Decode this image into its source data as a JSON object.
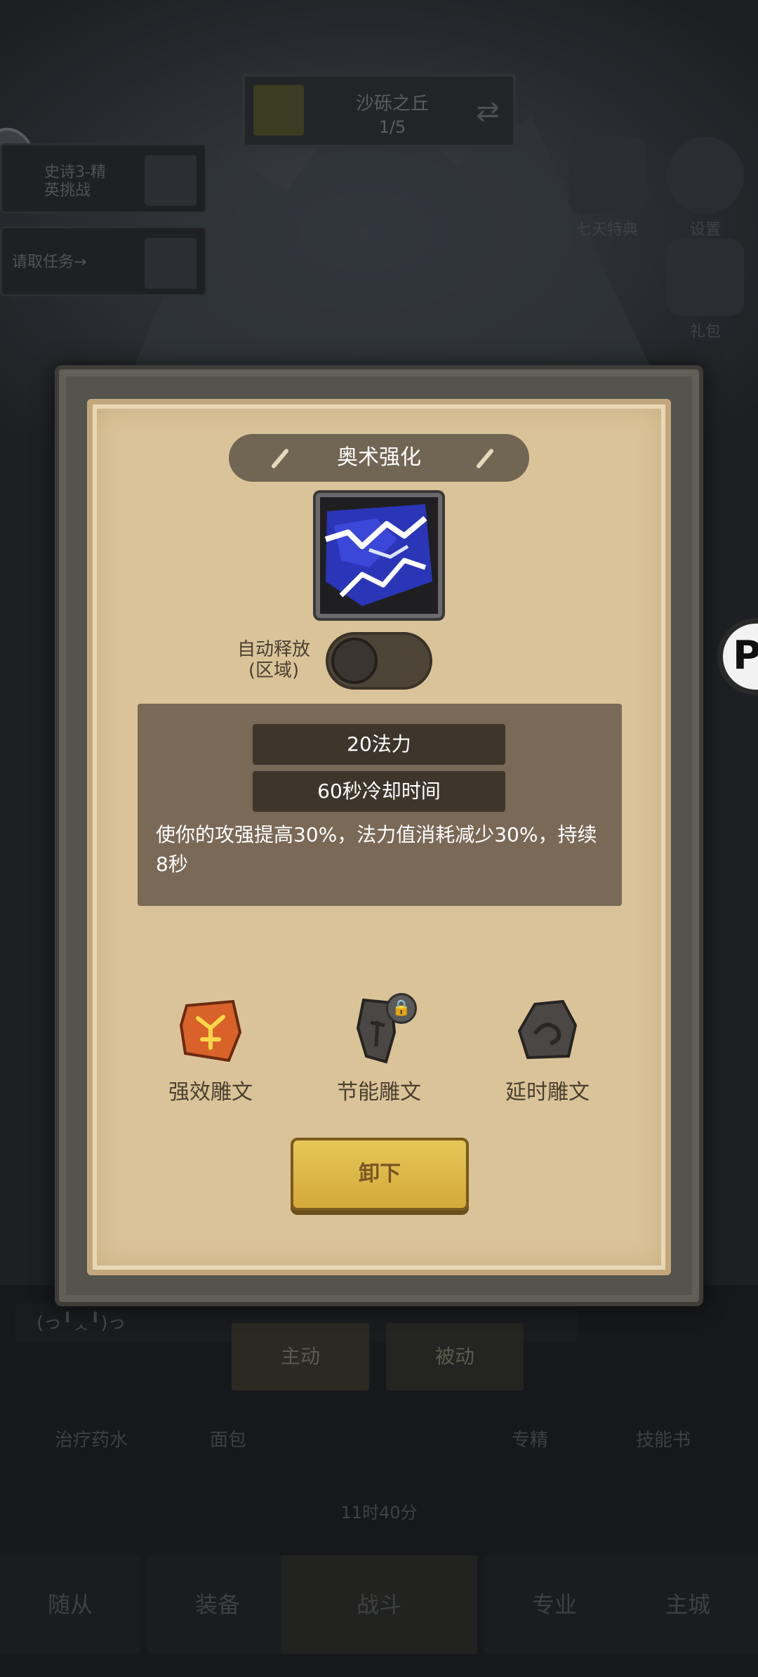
{
  "background": {
    "stage": {
      "name": "沙砾之丘",
      "progress": "1/5"
    },
    "tasks": [
      "史诗3-精\n英挑战",
      "请取任务→"
    ],
    "side_icons": [
      "七天特典",
      "设置",
      "礼包"
    ],
    "chat_placeholder": "(っ╹ᆺ╹)っ",
    "mode_tabs": [
      "主动",
      "被动"
    ],
    "items": [
      "治疗药水",
      "面包",
      "专精",
      "技能书"
    ],
    "timer": "11时40分",
    "nav": [
      "随从",
      "装备",
      "战斗",
      "专业",
      "主城"
    ],
    "edge_button": "P"
  },
  "modal": {
    "title": "奥术强化",
    "skill_icon": "arcane-lightning-icon",
    "auto_cast_label": "自动释放\n(区域)",
    "auto_cast_enabled": false,
    "cost": "20法力",
    "cooldown": "60秒冷却时间",
    "description": "使你的攻强提高30%，法力值消耗减少30%，持续8秒",
    "runes": [
      {
        "label": "强效雕文",
        "icon": "power-rune-icon",
        "color": "#d9622a",
        "locked": false
      },
      {
        "label": "节能雕文",
        "icon": "efficiency-rune-icon",
        "color": "#4a4744",
        "locked": true
      },
      {
        "label": "延时雕文",
        "icon": "duration-rune-icon",
        "color": "#4a4744",
        "locked": false
      }
    ],
    "unequip_label": "卸下"
  },
  "colors": {
    "paper": "#dbc399",
    "panel": "#7a6957",
    "button": "#e0bb4a",
    "rune_active": "#d9622a"
  }
}
